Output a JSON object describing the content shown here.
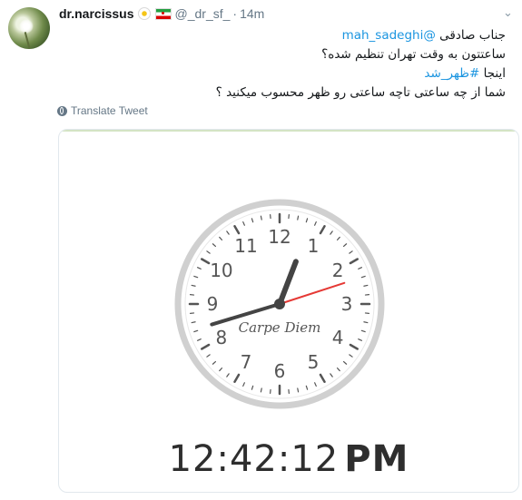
{
  "tweet": {
    "display_name": "dr.narcissus",
    "handle": "@_dr_sf_",
    "separator": "·",
    "time": "14m",
    "chevron": "⌄",
    "text_line1_prefix": "جناب صادقی ",
    "text_line1_mention": "@mah_sadeghi",
    "text_line2": "ساعتتون به وقت تهران تنظیم شده؟",
    "text_line3_prefix": "اینجا ",
    "text_line3_hashtag": "#ظهر_شد",
    "text_line4": "شما از چه ساعتی تاچه ساعتی رو ظهر محسوب میکنید ؟",
    "translate_label": "Translate Tweet",
    "icons": [
      "avatar",
      "flower-emoji-icon",
      "iran-flag-icon",
      "chevron-down-icon",
      "globe-icon"
    ]
  },
  "media": {
    "clock_brand": "Carpe Diem",
    "clock_numbers": [
      "12",
      "1",
      "2",
      "3",
      "4",
      "5",
      "6",
      "7",
      "8",
      "9",
      "10",
      "11"
    ],
    "digital_time": "12:42:12",
    "digital_ampm": "PM",
    "second_hand_color": "#e53935",
    "hand_color": "#444444"
  }
}
